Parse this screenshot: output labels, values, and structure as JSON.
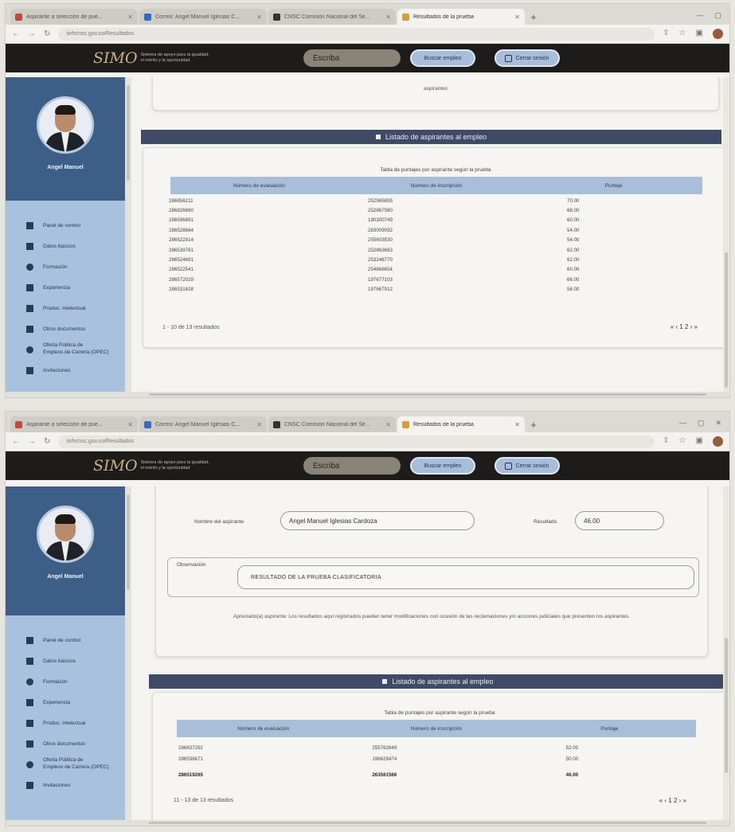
{
  "browser": {
    "tabs": [
      {
        "label": "Aspirante a selección de pue...",
        "color": "#c9453a"
      },
      {
        "label": "Correo: Angel Manuel Iglesias C...",
        "color": "#2f6cc9"
      },
      {
        "label": "CNSC Comisión Nacional del Se...",
        "color": "#333333"
      },
      {
        "label": "Resultados de la prueba",
        "color": "#d6a02b"
      }
    ],
    "url": "sirhcnsc.gov.co/Resultados"
  },
  "header": {
    "logo_mark": "SIMO",
    "logo_tagline_1": "Sistema de apoyo para la igualdad,",
    "logo_tagline_2": "el mérito y la oportunidad",
    "search_placeholder": "Escriba",
    "search_jobs_label": "Buscar empleo",
    "logout_label": "Cerrar sesión"
  },
  "sidebar": {
    "user_name": "Angel Manuel",
    "items": [
      {
        "label": "Panel de control",
        "icon": "dashboard-icon"
      },
      {
        "label": "Datos básicos",
        "icon": "user-data-icon"
      },
      {
        "label": "Formación",
        "icon": "graduation-icon"
      },
      {
        "label": "Experiencia",
        "icon": "briefcase-icon"
      },
      {
        "label": "Produc. intelectual",
        "icon": "book-icon"
      },
      {
        "label": "Otros documentos",
        "icon": "document-icon"
      },
      {
        "label": "Oferta Pública de",
        "label_2": "Empleos de Carrera (OPEC)",
        "icon": "globe-icon"
      },
      {
        "label": "Invitaciones",
        "icon": "invitation-icon"
      }
    ]
  },
  "top_view": {
    "card_text": "aspirantes",
    "section_title": "Listado de aspirantes al empleo",
    "table_caption": "Tabla de puntajes por aspirante según la prueba",
    "columns": [
      "Número de evaluación",
      "Número de inscripción",
      "Puntaje"
    ],
    "rows": [
      [
        "286856211",
        "252965895",
        "70.00"
      ],
      [
        "286826660",
        "252867580",
        "68.00"
      ],
      [
        "286596891",
        "190300749",
        "60.00"
      ],
      [
        "286528664",
        "283009092",
        "54.00"
      ],
      [
        "286522914",
        "255603530",
        "54.00"
      ],
      [
        "286539761",
        "252863663",
        "62.00"
      ],
      [
        "286524691",
        "253246770",
        "62.00"
      ],
      [
        "286522541",
        "254868654",
        "60.00"
      ],
      [
        "286572029",
        "197677103",
        "66.00"
      ],
      [
        "286531628",
        "197667912",
        "56.00"
      ]
    ],
    "pager_text": "1 - 10 de 13 resultados",
    "pagination": "« ‹ 1 2 › »"
  },
  "bottom_view": {
    "name_label": "Nombre del aspirante",
    "name_value": "Angel Manuel Iglesias Cardoza",
    "result_label": "Resultado",
    "result_value": "46.00",
    "observation_label": "Observación",
    "observation_value": "RESULTADO DE LA PRUEBA CLASIFICATORIA",
    "note": "Apreciado(a) aspirante: Los resultados aquí registrados pueden tener modificaciones con ocasión de las reclamaciones y/o acciones judiciales que presenten los aspirantes.",
    "section_title": "Listado de aspirantes al empleo",
    "table_caption": "Tabla de puntajes por aspirante según la prueba",
    "columns": [
      "Número de evaluación",
      "Número de inscripción",
      "Puntaje"
    ],
    "rows": [
      [
        "286637292",
        "255762849",
        "52.00"
      ],
      [
        "286538671",
        "196629474",
        "50.00"
      ],
      [
        "286519265",
        "263561566",
        "46.00"
      ]
    ],
    "pager_text": "11 - 13 de 13 resultados",
    "pagination": "« ‹ 1 2 › »"
  }
}
